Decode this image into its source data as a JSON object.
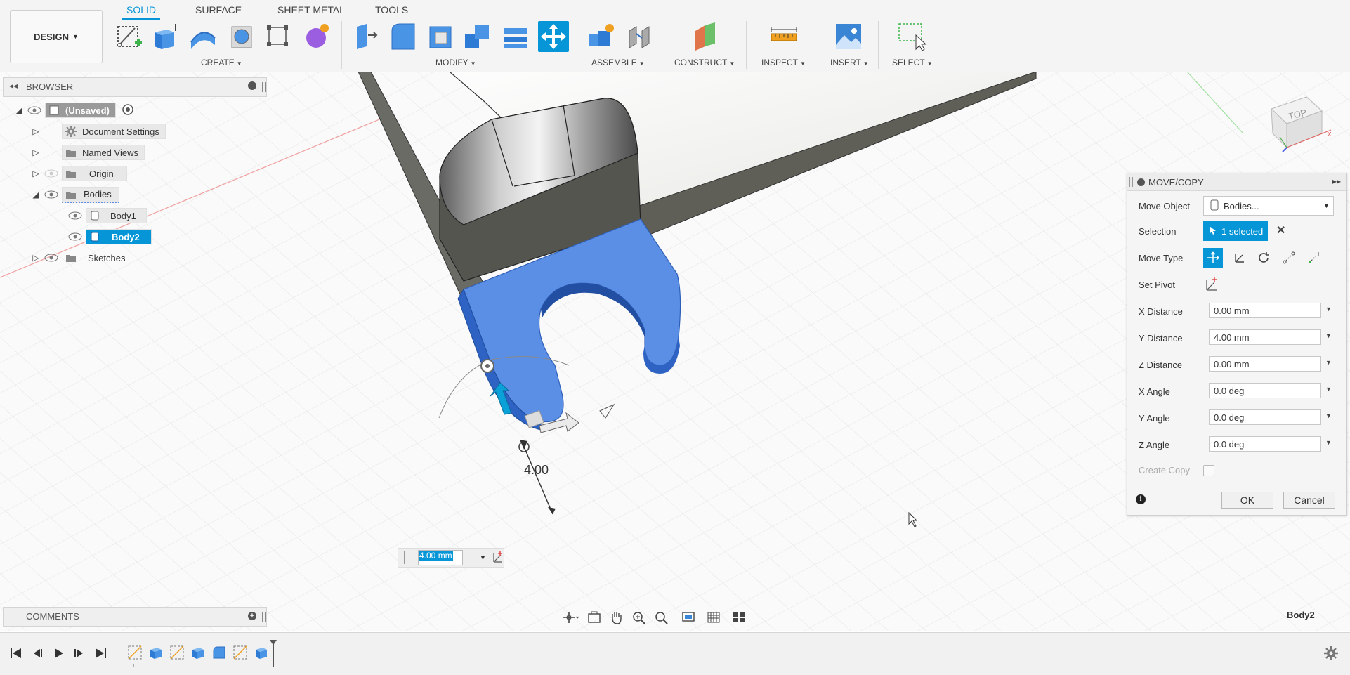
{
  "toolbar": {
    "workspace": "DESIGN",
    "tabs": [
      "SOLID",
      "SURFACE",
      "SHEET METAL",
      "TOOLS"
    ],
    "active_tab": "SOLID",
    "groups": {
      "create": "CREATE",
      "modify": "MODIFY",
      "assemble": "ASSEMBLE",
      "construct": "CONSTRUCT",
      "inspect": "INSPECT",
      "insert": "INSERT",
      "select": "SELECT"
    },
    "accent_color": "#0696d7"
  },
  "browser": {
    "title": "BROWSER",
    "root": "(Unsaved)",
    "items": [
      {
        "label": "Document Settings",
        "icon": "gear-icon"
      },
      {
        "label": "Named Views",
        "icon": "folder-icon"
      },
      {
        "label": "Origin",
        "icon": "folder-icon"
      },
      {
        "label": "Bodies",
        "icon": "folder-icon"
      },
      {
        "label": "Body1",
        "icon": "body-icon"
      },
      {
        "label": "Body2",
        "icon": "body-icon"
      },
      {
        "label": "Sketches",
        "icon": "folder-icon"
      }
    ]
  },
  "viewport": {
    "dimension_label": "4.00",
    "value_input": "4.00 mm",
    "viewcube_label": "TOP",
    "selected_body_label": "Body2",
    "body_color": "#5b8fe6"
  },
  "dialog": {
    "title": "MOVE/COPY",
    "move_object_label": "Move Object",
    "move_object_value": "Bodies...",
    "selection_label": "Selection",
    "selection_value": "1 selected",
    "move_type_label": "Move Type",
    "set_pivot_label": "Set Pivot",
    "fields": [
      {
        "label": "X Distance",
        "value": "0.00 mm"
      },
      {
        "label": "Y Distance",
        "value": "4.00 mm"
      },
      {
        "label": "Z Distance",
        "value": "0.00 mm"
      },
      {
        "label": "X Angle",
        "value": "0.0 deg"
      },
      {
        "label": "Y Angle",
        "value": "0.0 deg"
      },
      {
        "label": "Z Angle",
        "value": "0.0 deg"
      }
    ],
    "create_copy_label": "Create Copy",
    "ok_label": "OK",
    "cancel_label": "Cancel"
  },
  "comments": {
    "title": "COMMENTS"
  }
}
